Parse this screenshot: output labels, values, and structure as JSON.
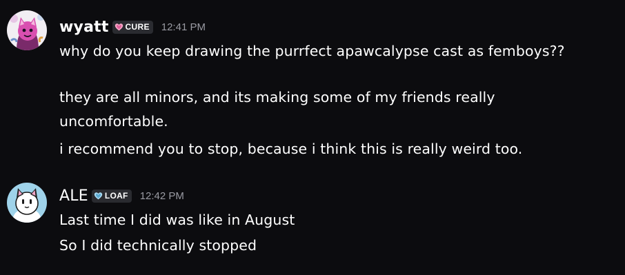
{
  "messages": [
    {
      "username": "wyatt",
      "tag": {
        "label": "CURE",
        "icon": "heart-icon",
        "icon_color": "#f7a8c8"
      },
      "timestamp": "12:41 PM",
      "avatar": "wyatt-avatar",
      "lines": [
        "why do you keep drawing the purrfect apawcalypse cast as femboys??",
        "they are all minors, and its making some of my friends really",
        "uncomfortable.",
        "i recommend you to stop, because i think this is really weird too."
      ]
    },
    {
      "username": "ALE",
      "tag": {
        "label": "LOAF",
        "icon": "heart-icon",
        "icon_color": "#a8d8f0"
      },
      "timestamp": "12:42 PM",
      "avatar": "ale-avatar",
      "lines": [
        "Last time I did was like in August",
        "So I did technically stopped"
      ]
    }
  ],
  "colors": {
    "background": "#0c0c0f",
    "text": "#ffffff",
    "timestamp": "#9a9ba3",
    "tag_bg": "#2a2b30"
  }
}
